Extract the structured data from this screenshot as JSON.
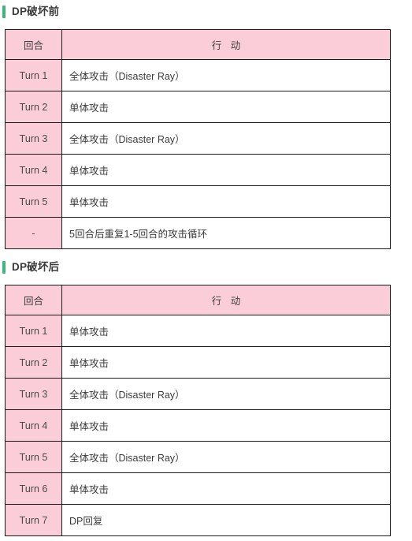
{
  "theme": {
    "accent_bar_color": "#3cb878",
    "header_pink": "#fbcdd8",
    "cell_pink": "#fbcdd8",
    "border_color": "#1a1a1a",
    "text_color": "#3b3b3b",
    "body_background": "#ffffff"
  },
  "sections": [
    {
      "heading": "DP破坏前",
      "table": {
        "columns": [
          "回合",
          "行 动"
        ],
        "rows": [
          {
            "turn": "Turn 1",
            "action": "全体攻击（Disaster Ray）"
          },
          {
            "turn": "Turn 2",
            "action": "单体攻击"
          },
          {
            "turn": "Turn 3",
            "action": "全体攻击（Disaster Ray）"
          },
          {
            "turn": "Turn 4",
            "action": "单体攻击"
          },
          {
            "turn": "Turn 5",
            "action": "单体攻击"
          },
          {
            "turn": "-",
            "action": "5回合后重复1-5回合的攻击循环"
          }
        ]
      }
    },
    {
      "heading": "DP破坏后",
      "table": {
        "columns": [
          "回合",
          "行 动"
        ],
        "rows": [
          {
            "turn": "Turn 1",
            "action": "单体攻击"
          },
          {
            "turn": "Turn 2",
            "action": "单体攻击"
          },
          {
            "turn": "Turn 3",
            "action": "全体攻击（Disaster Ray）"
          },
          {
            "turn": "Turn 4",
            "action": "单体攻击"
          },
          {
            "turn": "Turn 5",
            "action": "全体攻击（Disaster Ray）"
          },
          {
            "turn": "Turn 6",
            "action": "单体攻击"
          },
          {
            "turn": "Turn 7",
            "action": "DP回复"
          }
        ]
      }
    }
  ]
}
